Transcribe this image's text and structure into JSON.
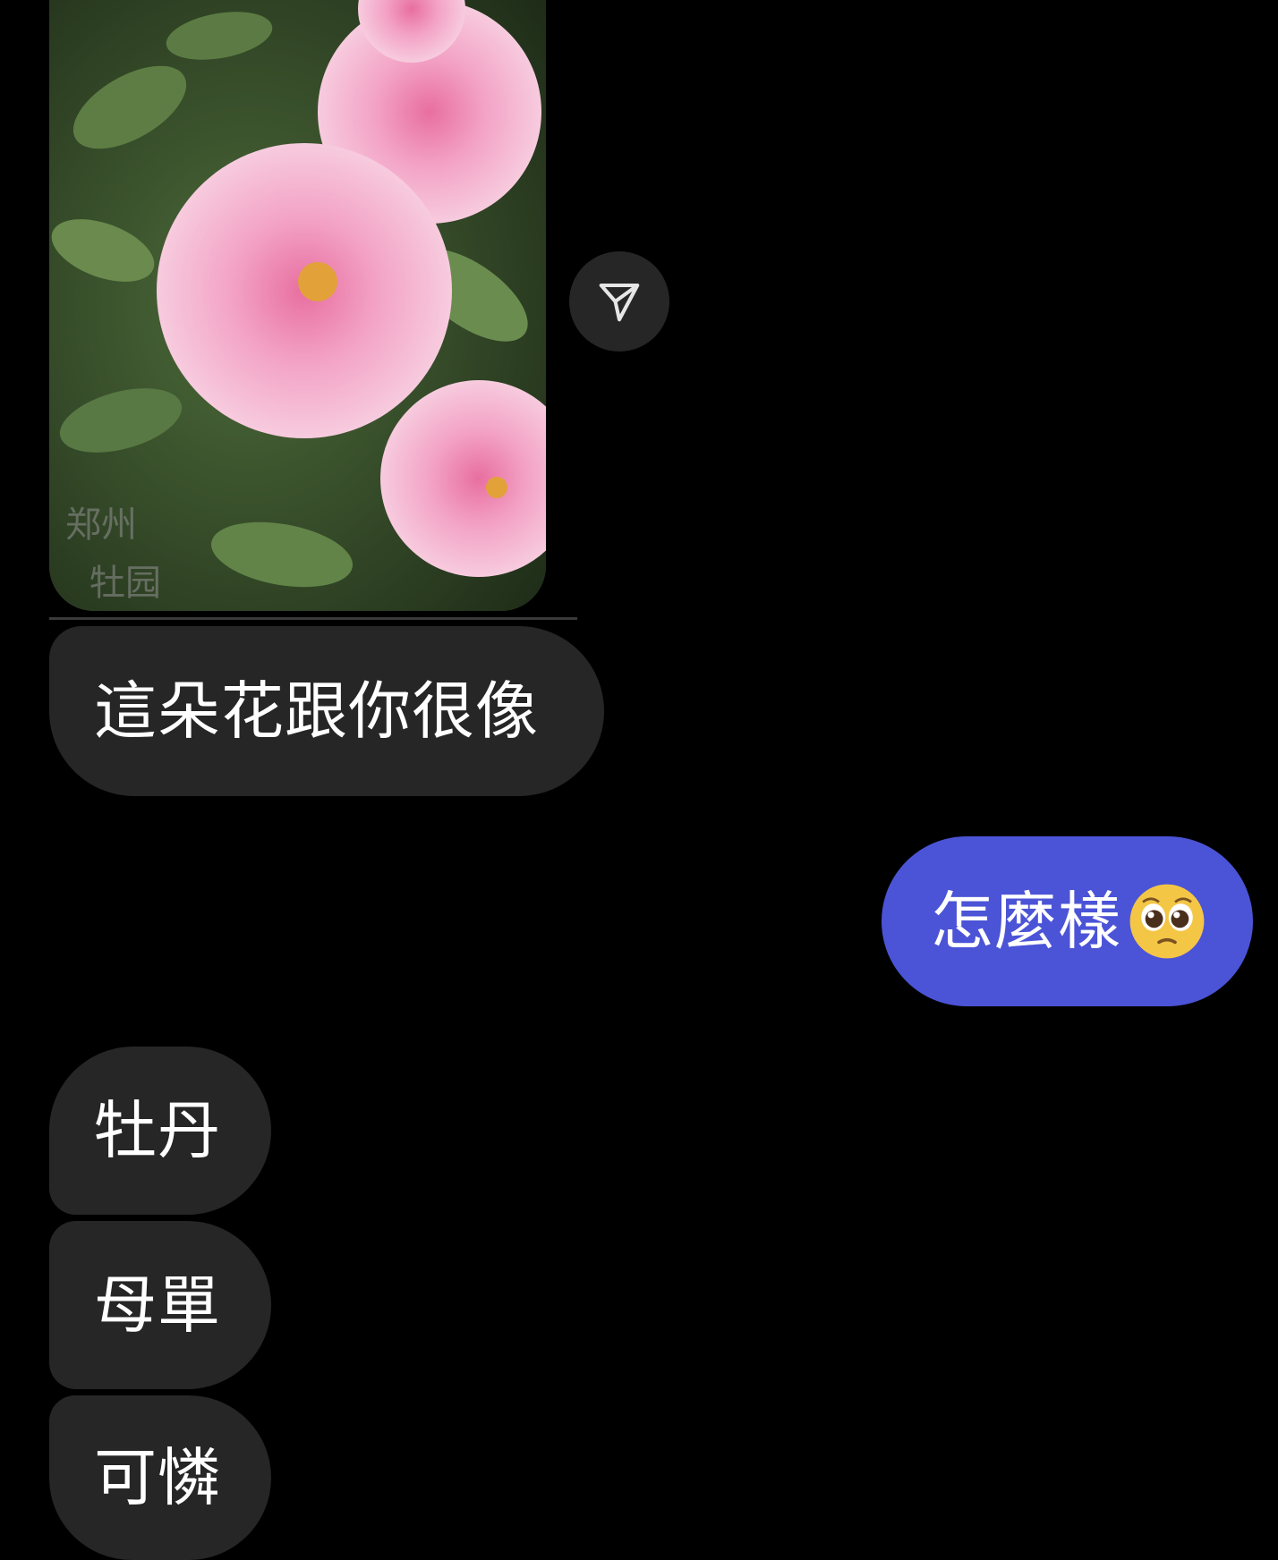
{
  "messages": {
    "image": {
      "icon": "shared-flower-photo",
      "description_colors": [
        "#f2a6c8",
        "#3f5b2e"
      ]
    },
    "share_icon": "send-arrow-icon",
    "incoming_1": "這朵花跟你很像",
    "outgoing_1": "怎麼樣",
    "outgoing_1_emoji": "pleading-face-emoji",
    "incoming_2": "牡丹",
    "incoming_3": "母單",
    "incoming_4": "可憐"
  },
  "colors": {
    "background": "#000000",
    "incoming_bubble": "#262626",
    "outgoing_bubble": "#4b54d6",
    "text": "#ffffff"
  }
}
